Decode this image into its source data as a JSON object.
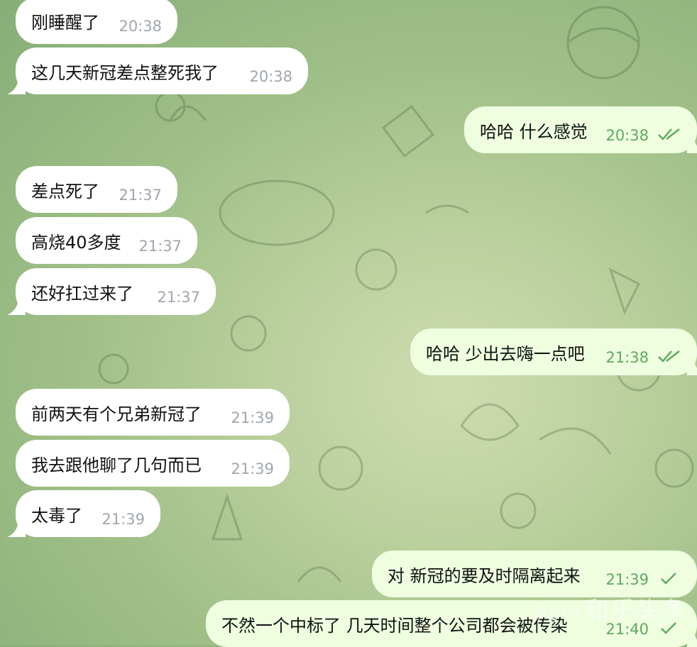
{
  "messages": [
    {
      "dir": "in",
      "text": "刚睡醒了",
      "time": "20:38",
      "tail": false
    },
    {
      "dir": "in",
      "text": "这几天新冠差点整死我了",
      "time": "20:38",
      "tail": true
    },
    {
      "dir": "out",
      "text": "哈哈 什么感觉",
      "time": "20:38",
      "read": true,
      "tail": true
    },
    {
      "dir": "in",
      "text": "差点死了",
      "time": "21:37",
      "tail": false
    },
    {
      "dir": "in",
      "text": "高烧40多度",
      "time": "21:37",
      "tail": false
    },
    {
      "dir": "in",
      "text": "还好扛过来了",
      "time": "21:37",
      "tail": true
    },
    {
      "dir": "out",
      "text": "哈哈 少出去嗨一点吧",
      "time": "21:38",
      "read": true,
      "tail": true
    },
    {
      "dir": "in",
      "text": "前两天有个兄弟新冠了",
      "time": "21:39",
      "tail": false
    },
    {
      "dir": "in",
      "text": "我去跟他聊了几句而已",
      "time": "21:39",
      "tail": false
    },
    {
      "dir": "in",
      "text": "太毒了",
      "time": "21:39",
      "tail": true
    },
    {
      "dir": "out",
      "text": "对 新冠的要及时隔离起来",
      "time": "21:39",
      "read": false,
      "tail": false
    },
    {
      "dir": "out",
      "text": "不然一个中标了 几天时间整个公司都会被传染",
      "time": "21:40",
      "read": false,
      "tail": true
    }
  ],
  "watermark": {
    "logo": "Bolo",
    "text": "和乐头条"
  },
  "colors": {
    "incoming": "#ffffff",
    "outgoing": "#eefedf",
    "time_in": "#a0a6ad",
    "time_out": "#5fa85f"
  }
}
